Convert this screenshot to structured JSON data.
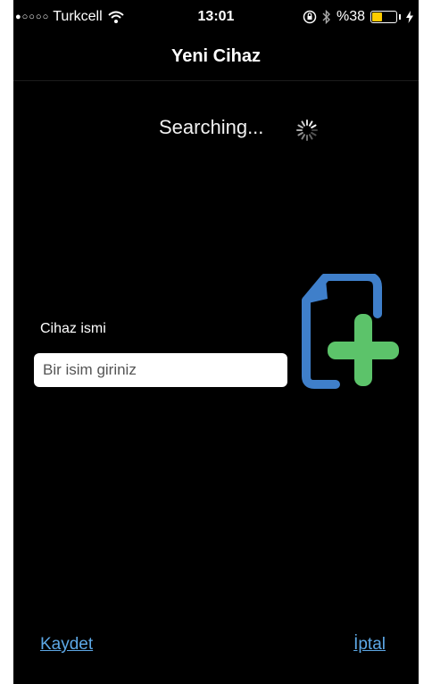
{
  "status_bar": {
    "signal_dots": "●○○○○",
    "carrier": "Turkcell",
    "time": "13:01",
    "battery_text": "%38",
    "battery_level": 0.38,
    "battery_color": "#ffcc00"
  },
  "nav": {
    "title": "Yeni Cihaz"
  },
  "search": {
    "status_text": "Searching..."
  },
  "device_form": {
    "name_label": "Cihaz ismi",
    "name_placeholder": "Bir isim giriniz",
    "name_value": ""
  },
  "icons": {
    "add_file": "add-file-icon",
    "wifi": "wifi-icon",
    "rotation_lock": "rotation-lock-icon",
    "bluetooth": "bluetooth-icon",
    "charging": "charging-bolt-icon",
    "spinner": "loading-spinner-icon"
  },
  "colors": {
    "background": "#000000",
    "link": "#5da8e6",
    "file_blue": "#3f7fca",
    "plus_green": "#5cc36a"
  },
  "actions": {
    "save_label": "Kaydet",
    "cancel_label": "İptal"
  }
}
